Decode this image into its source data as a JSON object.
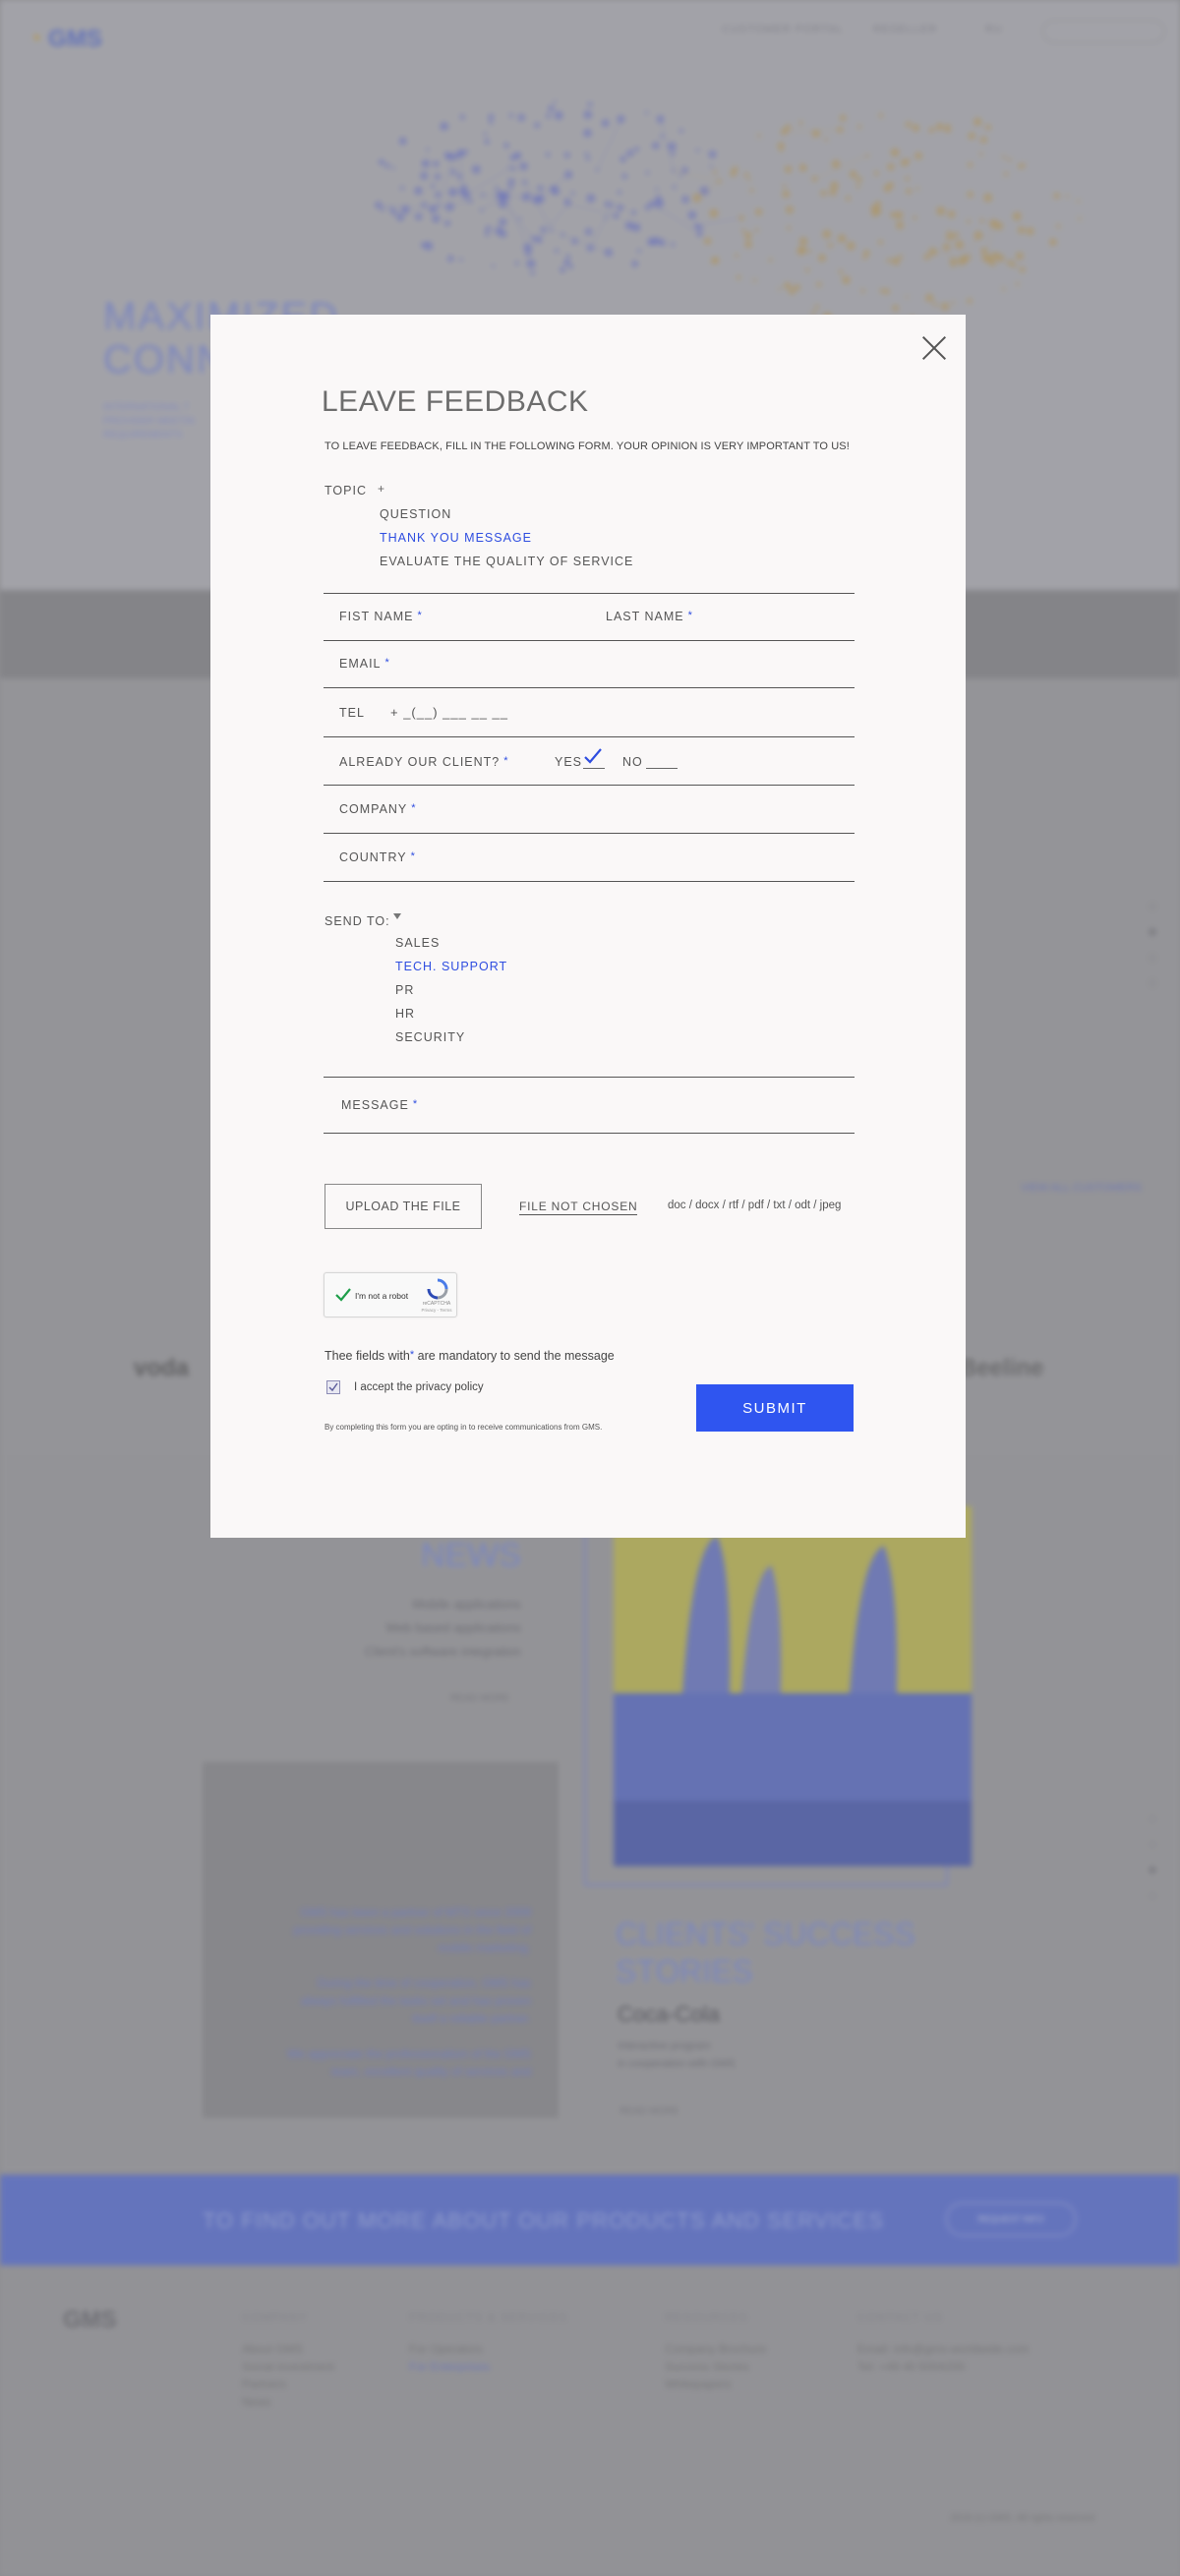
{
  "background": {
    "logo": "GMS",
    "nav": [
      "CUSTOMER PORTAL",
      "RESELLER",
      "RU"
    ],
    "hero_title_lines": [
      "MAXIMIZED",
      "CONN"
    ],
    "hero_sub_lines": [
      "INTERNATIONAL T",
      "PROVIDER MEETIN",
      "REQUIREMENTS"
    ],
    "view_all": "VIEW ALL CUSTOMERS",
    "partners": [
      "voda",
      "Beeline"
    ],
    "news_title": "NEWS",
    "news_items": [
      "Mobile applications",
      "Web based applications",
      "Client's software integration"
    ],
    "read_more": "READ MORE",
    "card_text": [
      "GMS has been a partner of MTS since 2009",
      "providing services and solutions in the field of",
      "mobile marketing.",
      "During the time of cooperation, GMS has",
      "always fulfilled the tasks set and has proven",
      "itself a reliable partner.",
      "We appreciate the professionalism of the GMS",
      "team, excellent quality of services and"
    ],
    "clients_title_lines": [
      "CLIENTS' SUCCESS",
      "STORIES"
    ],
    "client_name": "Coca-Cola",
    "client_sub": [
      "Interactive program",
      "in cooperation with GMS"
    ],
    "banner_text": "TO FIND OUT MORE ABOUT OUR PRODUCTS AND SERVICES",
    "banner_button": "REQUEST INFO",
    "footer_cols": [
      {
        "title": "COMPANY",
        "items": [
          "About GMS",
          "Social investment",
          "Partners",
          "News"
        ]
      },
      {
        "title": "PRODUCTS & SERVICES",
        "items": [
          "For Operators",
          "For Enterprises"
        ]
      },
      {
        "title": "RESOURCES",
        "items": [
          "Company Brochure",
          "Success Stories",
          "Whitepapers"
        ]
      },
      {
        "title": "CONTACT US",
        "items": [
          "Email: info@gms-worldwide.com",
          "Tel: +49 40 5004200"
        ]
      }
    ],
    "copyright": "2018 (c) GMS. All rights reserved"
  },
  "modal": {
    "title": "LEAVE FEEDBACK",
    "intro": "TO LEAVE FEEDBACK, FILL IN THE FOLLOWING FORM. YOUR OPINION IS VERY IMPORTANT TO US!",
    "topic_label": "TOPIC",
    "topic_caret": "+",
    "topic_options": [
      "QUESTION",
      "THANK YOU MESSAGE",
      "EVALUATE THE QUALITY OF SERVICE"
    ],
    "topic_selected": "THANK YOU MESSAGE",
    "first_name_label": "FIST NAME",
    "last_name_label": "LAST NAME",
    "email_label": "EMAIL",
    "tel_label": "TEL",
    "tel_mask": "+ _(__) ___ __ __",
    "client_label": "ALREADY OUR CLIENT?",
    "yes_label": "YES",
    "no_label": "NO",
    "client_selected": "YES",
    "company_label": "COMPANY",
    "country_label": "COUNTRY",
    "send_to_label": "SEND TO:",
    "send_to_options": [
      "SALES",
      "TECH. SUPPORT",
      "PR",
      "HR",
      "SECURITY"
    ],
    "send_to_selected": "TECH. SUPPORT",
    "message_label": "MESSAGE",
    "required_mark": "*",
    "upload_button": "UPLOAD THE FILE",
    "file_status": "FILE NOT CHOSEN",
    "file_types": "doc / docx / rtf / pdf / txt / odt / jpeg",
    "recaptcha_label": "I'm not a robot",
    "recaptcha_brand": "reCAPTCHA",
    "recaptcha_terms": "Privacy - Terms",
    "mandatory_note_pre": "Thee fields with",
    "mandatory_note_post": " are mandatory to send the message",
    "privacy_label": "I accept the privacy policy",
    "privacy_checked": true,
    "optin_note": "By completing this form you are opting in to receive communications from GMS.",
    "submit_label": "SUBMIT",
    "accent_color": "#2f55f0"
  }
}
